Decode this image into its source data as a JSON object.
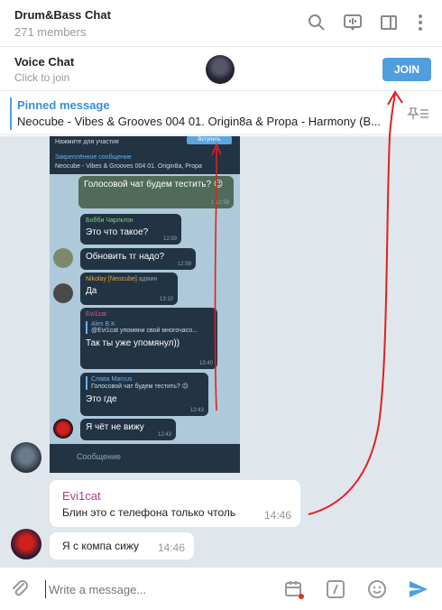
{
  "header": {
    "title": "Drum&Bass Chat",
    "subtitle": "271 members",
    "icons": [
      "search-icon",
      "voice-chat-icon",
      "sidebar-icon",
      "more-icon"
    ]
  },
  "voice_chat": {
    "title": "Voice Chat",
    "subtitle": "Click to join",
    "join_label": "JOIN"
  },
  "pinned": {
    "title": "Pinned message",
    "text": "Neocube - Vibes & Grooves 004   01. Origin8a & Propa - Harmony (B..."
  },
  "screenshot": {
    "top_label": "Нажмите для участия",
    "join_label": "Вступить",
    "pinned_title": "Закреплённое сообщение",
    "pinned_text": "Neocube - Vibes & Grooves 004   01. Origin8a, Propa",
    "messages": [
      {
        "name": "",
        "text": "Голосовой чат будем тестить? 😉",
        "time": "1  12:59",
        "out": true
      },
      {
        "name": "Бобби Чарльтон",
        "text": "Это что такое?",
        "time": "12:59"
      },
      {
        "name": "",
        "text": "Обновить тг надо?",
        "time": "12:59"
      },
      {
        "name": "Nikolay [Neocube]",
        "badge": "админ",
        "text": "Да",
        "time": "13:10"
      },
      {
        "name": "Evi1cat",
        "quote_name": "Alex B.K",
        "quote_text": "@Evi1cat упомяни свой многочасо...",
        "text": "Так ты уже упомянул))",
        "time": "13:40"
      },
      {
        "name": "Слава Marcus",
        "quote_name": "",
        "quote_text": "Голосовой чат будем тестить? 😉",
        "text": "Это где",
        "time": "12:43"
      },
      {
        "name": "",
        "text": "Я чёт не вижу",
        "time": "12:43"
      }
    ],
    "compose_placeholder": "Сообщение"
  },
  "messages": [
    {
      "name": "Evi1cat",
      "text": "Блин это с телефона только чтоль",
      "time": "14:46"
    },
    {
      "name": "",
      "text": "Я с компа сижу",
      "time": "14:46"
    }
  ],
  "input": {
    "placeholder": "Write a message..."
  },
  "colors": {
    "accent": "#4f9fdf",
    "sender_name": "#b03c8c",
    "annotation": "#e0201e"
  }
}
